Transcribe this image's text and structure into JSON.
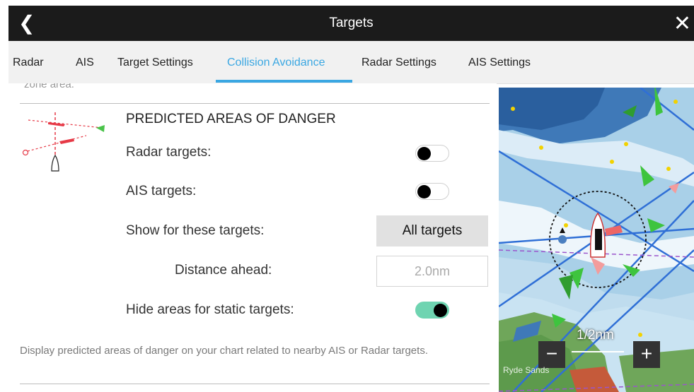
{
  "window": {
    "title": "Targets"
  },
  "icons": {
    "back": "chevron-left-icon",
    "close": "close-icon"
  },
  "tabs": [
    {
      "label": "Radar"
    },
    {
      "label": "AIS"
    },
    {
      "label": "Target Settings"
    },
    {
      "label": "Collision Avoidance",
      "active": true
    },
    {
      "label": "Radar Settings"
    },
    {
      "label": "AIS Settings"
    }
  ],
  "panel": {
    "cut_text": "zone area.",
    "section_title": "PREDICTED AREAS OF DANGER",
    "radar_targets": {
      "label": "Radar targets:",
      "on": false
    },
    "ais_targets": {
      "label": "AIS targets:",
      "on": false
    },
    "show_for": {
      "label": "Show for these targets:",
      "value": "All targets"
    },
    "distance_ahead": {
      "label": "Distance ahead:",
      "value": "2.0nm"
    },
    "hide_static": {
      "label": "Hide areas for static targets:",
      "on": true
    },
    "description": "Display predicted areas of danger on your chart related to nearby AIS or Radar targets."
  },
  "map": {
    "scale_label": "1/2nm",
    "zoom_out": "−",
    "zoom_in": "+",
    "place_label": "Ryde Sands"
  },
  "colors": {
    "accent": "#3aa7e2",
    "toggle_on": "#6fd4b1",
    "title_bar": "#1b1b1b"
  }
}
